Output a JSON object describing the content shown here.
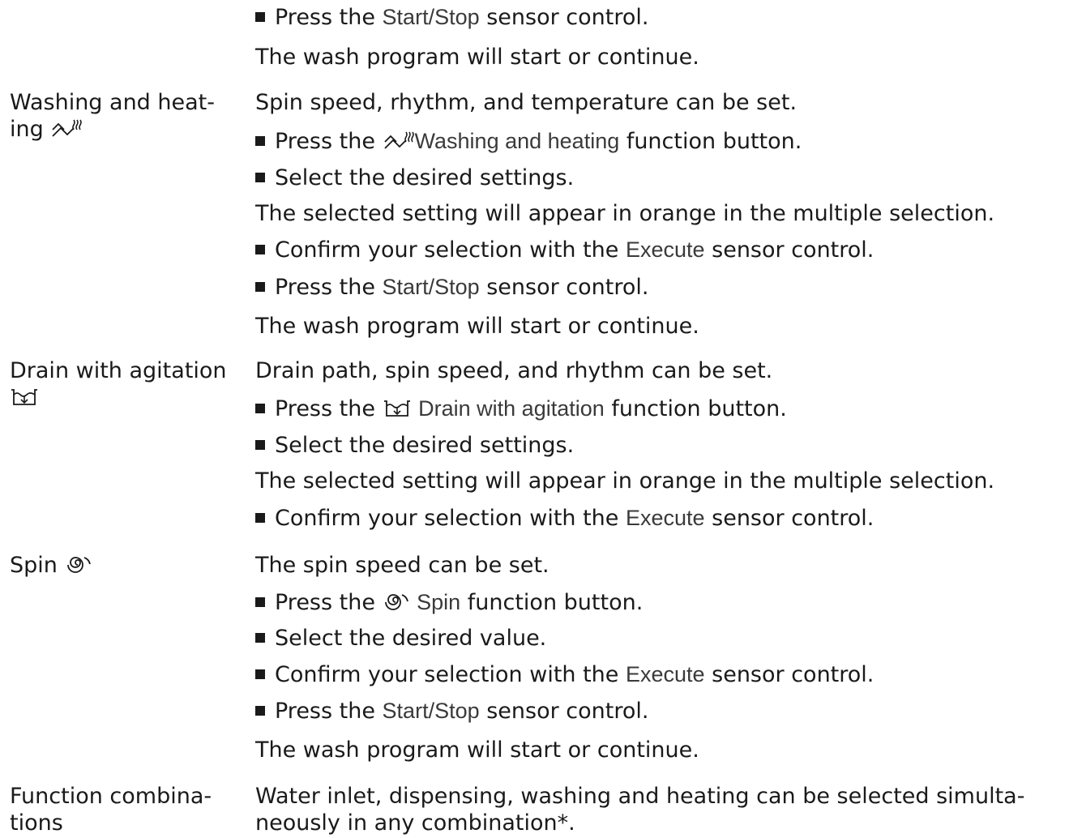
{
  "rows": {
    "start_continue": {
      "step1": {
        "pre": "Press the ",
        "ui": "Start/Stop",
        "post": " sensor control."
      },
      "result": "The wash program will start or continue."
    },
    "washing_heating": {
      "label_line1": "Washing and heat-",
      "label_line2": "ing",
      "icon": "washing-heating-icon",
      "intro": "Spin speed, rhythm, and temperature can be set.",
      "step1": {
        "pre": "Press the ",
        "ui": "Washing and heating",
        "post": " function button."
      },
      "step2": "Select the desired settings.",
      "note": "The selected setting will appear in orange in the multiple selection.",
      "step3": {
        "pre": "Confirm your selection with the ",
        "ui": "Execute",
        "post": " sensor control."
      },
      "step4": {
        "pre": "Press the ",
        "ui": "Start/Stop",
        "post": " sensor control."
      },
      "result": "The wash program will start or continue."
    },
    "drain_agitation": {
      "label": "Drain with agitation",
      "icon": "drain-agitation-icon",
      "intro": "Drain path, spin speed, and rhythm can be set.",
      "step1": {
        "pre": "Press the ",
        "ui": "Drain with agitation",
        "post": " function button."
      },
      "step2": "Select the desired settings.",
      "note": "The selected setting will appear in orange in the multiple selection.",
      "step3": {
        "pre": "Confirm your selection with the ",
        "ui": "Execute",
        "post": " sensor control."
      }
    },
    "spin": {
      "label": "Spin",
      "icon": "spin-icon",
      "intro": "The spin speed can be set.",
      "step1": {
        "pre": "Press the ",
        "ui": "Spin",
        "post": " function button."
      },
      "step2": "Select the desired value.",
      "step3": {
        "pre": "Confirm your selection with the ",
        "ui": "Execute",
        "post": " sensor control."
      },
      "step4": {
        "pre": "Press the ",
        "ui": "Start/Stop",
        "post": " sensor control."
      },
      "result": "The wash program will start or continue."
    },
    "function_combinations": {
      "label_line1": "Function combina-",
      "label_line2": "tions",
      "body_line1": "Water inlet, dispensing, washing and heating can be selected simulta-",
      "body_line2": "neously in any combination*."
    }
  }
}
